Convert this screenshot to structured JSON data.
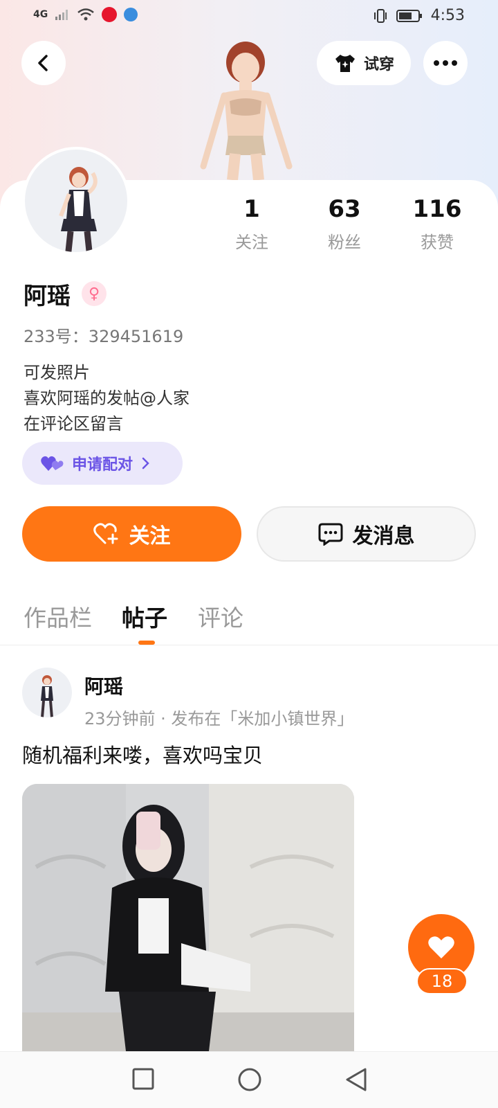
{
  "status_bar": {
    "network": "4G",
    "time": "4:53"
  },
  "top_bar": {
    "try_on_label": "试穿"
  },
  "profile": {
    "name": "阿瑶",
    "gender_symbol": "♀",
    "uid": "233号：329451619",
    "bio": [
      "可发照片",
      "喜欢阿瑶的发帖@人家",
      "在评论区留言"
    ],
    "stats": [
      {
        "value": "1",
        "label": "关注"
      },
      {
        "value": "63",
        "label": "粉丝"
      },
      {
        "value": "116",
        "label": "获赞"
      }
    ],
    "pair_label": "申请配对",
    "follow_label": "关注",
    "message_label": "发消息"
  },
  "tabs": [
    {
      "label": "作品栏",
      "active": false
    },
    {
      "label": "帖子",
      "active": true
    },
    {
      "label": "评论",
      "active": false
    }
  ],
  "post": {
    "author": "阿瑶",
    "meta": "23分钟前 · 发布在「米加小镇世界」",
    "text": "随机福利来喽，喜欢吗宝贝",
    "likes": "18"
  },
  "colors": {
    "accent": "#ff7614",
    "pair": "#6b54e6"
  }
}
